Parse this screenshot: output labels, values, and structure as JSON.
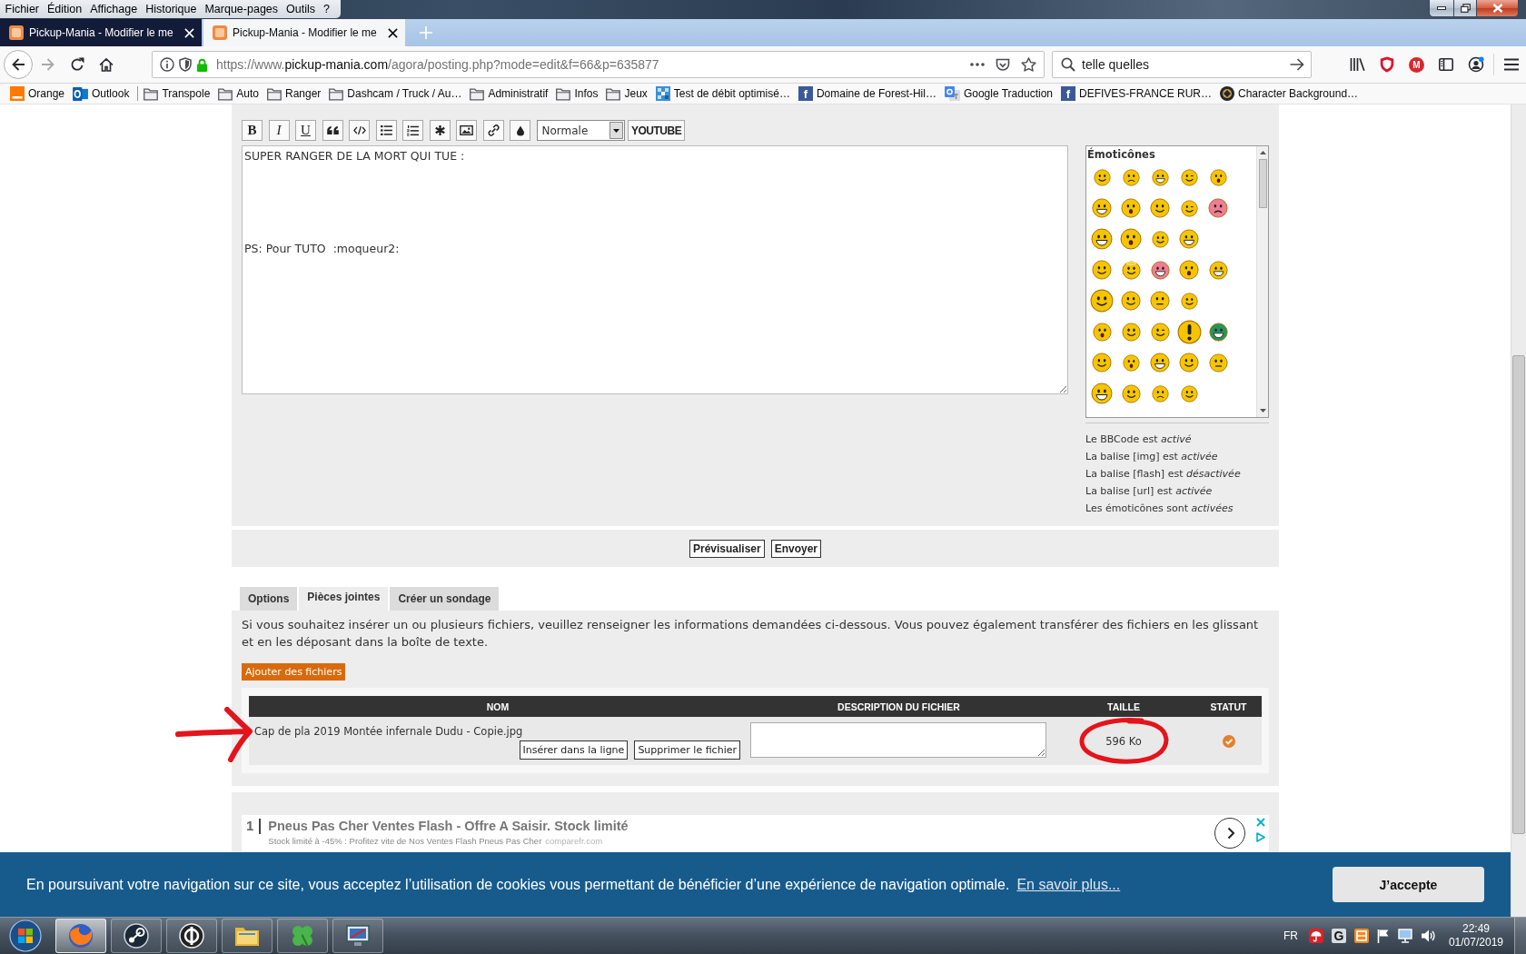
{
  "window": {
    "menu": [
      "Fichier",
      "Édition",
      "Affichage",
      "Historique",
      "Marque-pages",
      "Outils",
      "?"
    ]
  },
  "tabs": [
    {
      "title": "Pickup-Mania - Modifier le me",
      "selected": false
    },
    {
      "title": "Pickup-Mania - Modifier le me",
      "selected": true
    }
  ],
  "navigation": {
    "url": {
      "scheme": "https://www.",
      "host": "pickup-mania.com",
      "path": "/agora/posting.php?mode=edit&f=66&p=635877"
    },
    "search": {
      "value": "telle quelles"
    },
    "extensions": [
      {
        "kind": "shield"
      },
      {
        "kind": "badge",
        "label": "M"
      }
    ]
  },
  "bookmarks": [
    {
      "label": "Orange",
      "kind": "tile"
    },
    {
      "label": "Outlook",
      "kind": "mail"
    },
    {
      "kind": "separator"
    },
    {
      "label": "Transpole",
      "kind": "folder"
    },
    {
      "label": "Auto",
      "kind": "folder"
    },
    {
      "label": "Ranger",
      "kind": "folder"
    },
    {
      "label": "Dashcam / Truck / Au…",
      "kind": "folder"
    },
    {
      "label": "Administratif",
      "kind": "folder"
    },
    {
      "label": "Infos",
      "kind": "folder"
    },
    {
      "label": "Jeux",
      "kind": "folder"
    },
    {
      "label": "Test de débit optimisé…",
      "kind": "grid"
    },
    {
      "label": "Domaine de Forest-Hil…",
      "kind": "letter",
      "mark": "f"
    },
    {
      "label": "Google Traduction",
      "kind": "translate"
    },
    {
      "label": "DEFIVES-FRANCE RUR…",
      "kind": "letter",
      "mark": "f"
    },
    {
      "label": "Character Background…",
      "kind": "emblem"
    }
  ],
  "editor": {
    "toolbar": [
      {
        "kind": "bold",
        "label": "B"
      },
      {
        "kind": "italic",
        "label": "I"
      },
      {
        "kind": "underline",
        "label": "U"
      },
      {
        "kind": "quote"
      },
      {
        "kind": "code"
      },
      {
        "kind": "list"
      },
      {
        "kind": "numbered-list"
      },
      {
        "kind": "asterisk"
      },
      {
        "kind": "image"
      },
      {
        "kind": "link"
      },
      {
        "kind": "color"
      },
      {
        "kind": "select",
        "value": "Normale"
      },
      {
        "kind": "label",
        "label": "YOUTUBE"
      }
    ],
    "message": "SUPER RANGER DE LA MORT QUI TUE :\n\n\n\n\nPS: Pour TUTO  :moqueur2:",
    "emoticons_title": "Émoticônes",
    "status_lines": [
      "Le BBCode est *activé*",
      "La balise [img] est *activée*",
      "La balise [flash] est *désactivée*",
      "La balise [url] est *activée*",
      "Les émoticônes sont *activées*"
    ]
  },
  "actions": [
    "Prévisualiser",
    "Envoyer"
  ],
  "panel_tabs": [
    {
      "label": "Options",
      "selected": false
    },
    {
      "label": "Pièces jointes",
      "selected": true
    },
    {
      "label": "Créer un sondage",
      "selected": false
    }
  ],
  "attachments": {
    "intro": "Si vous souhaitez insérer un ou plusieurs fichiers, veuillez renseigner les informations demandées ci-dessous. Vous pouvez également transférer des fichiers en les glissant et en les déposant dans la boîte de texte.",
    "add_button": "Ajouter des fichiers",
    "columns": [
      "NOM",
      "DESCRIPTION DU FICHIER",
      "TAILLE",
      "STATUT"
    ],
    "files": [
      {
        "name": "Cap de pla 2019 Montée infernale Dudu - Copie.jpg",
        "actions": [
          "Insérer dans la ligne",
          "Supprimer le fichier"
        ],
        "size": "596 Ko"
      }
    ]
  },
  "ad": {
    "rank": "1",
    "title": "Pneus Pas Cher Ventes Flash - Offre A Saisir. Stock limité",
    "description": "Stock limité à -45% : Profitez vite de Nos Ventes Flash Pneus Pas Cher",
    "source": "comparefr.com"
  },
  "cookie_banner": {
    "text": "En poursuivant votre navigation sur ce site, vous acceptez l’utilisation de cookies vous permettant de bénéficier d’une expérience de navigation optimale.",
    "link": "En savoir plus...",
    "button": "J’accepte"
  },
  "taskbar": {
    "apps": [
      {
        "kind": "browser",
        "selected": true
      },
      {
        "kind": "game",
        "selected": false
      },
      {
        "kind": "media",
        "selected": false
      },
      {
        "kind": "files",
        "selected": false
      },
      {
        "kind": "clover",
        "selected": false
      },
      {
        "kind": "monitor",
        "selected": false
      }
    ],
    "language": "FR",
    "tray": [
      {
        "kind": "umbrella"
      },
      {
        "kind": "letter",
        "label": "G"
      },
      {
        "kind": "box"
      },
      {
        "kind": "flag"
      },
      {
        "kind": "network"
      },
      {
        "kind": "speaker"
      }
    ],
    "time": "22:49",
    "date": "01/07/2019"
  }
}
